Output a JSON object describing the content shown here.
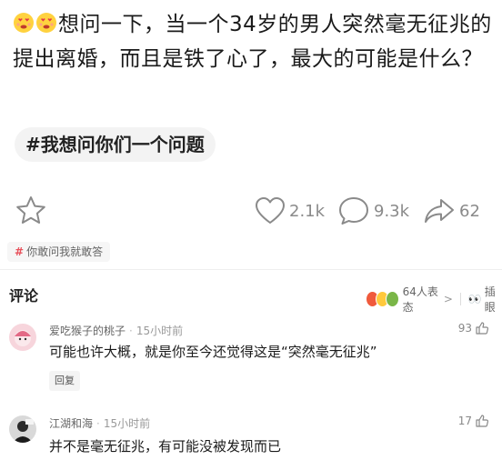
{
  "post": {
    "emoji_1": "love-face-emoji",
    "emoji_2": "love-face-emoji",
    "text": "想问一下，当一个34岁的男人突然毫无征兆的提出离婚，而且是铁了心了，最大的可能是什么？",
    "topic": "#我想问你们一个问题"
  },
  "actions": {
    "star_icon": "star-icon",
    "likes": "2.1k",
    "comments": "9.3k",
    "shares": "62"
  },
  "ask_chip": {
    "hash": "#",
    "label": "你敢问我就敢答"
  },
  "comments_section": {
    "title": "评论",
    "reactions_count": "64人表态",
    "reactions_chevron": ">",
    "peek_label": "插眼"
  },
  "comments": [
    {
      "name": "爱吃猴子的桃子",
      "time": "15小时前",
      "text": "可能也许大概，就是你至今还觉得这是“突然毫无征兆”",
      "likes": "93",
      "reply_label": "回复"
    },
    {
      "name": "江湖和海",
      "time": "15小时前",
      "text": "并不是毫无征兆，有可能没被发现而已",
      "likes": "17"
    }
  ],
  "colors": {
    "accent_red": "#e8515b",
    "icon_gray": "#8a8a8a",
    "text_dark": "#1a1a1a"
  }
}
